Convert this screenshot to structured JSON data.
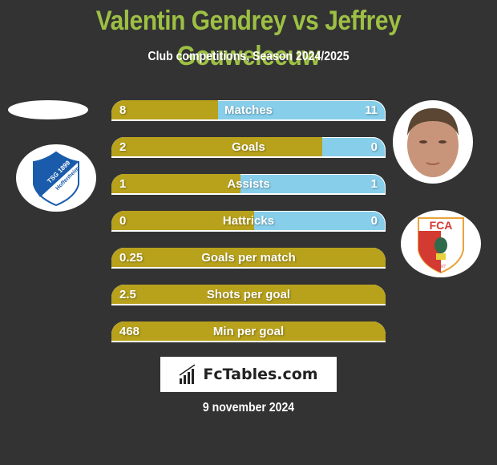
{
  "header": {
    "title": "Valentin Gendrey vs Jeffrey Gouweleeuw",
    "subtitle": "Club competitions, Season 2024/2025"
  },
  "players": {
    "left": {
      "name": "Valentin Gendrey",
      "club_logo": "tsg-1899-hoffenheim-logo",
      "club_text": "TSG 1899 Hoffenheim"
    },
    "right": {
      "name": "Jeffrey Gouweleeuw",
      "club_logo": "fc-augsburg-logo",
      "club_text": "FCA 1907"
    }
  },
  "colors": {
    "title": "#9dc044",
    "left_bar": "#b8a21c",
    "right_bar": "#87ceeb",
    "background": "#333333"
  },
  "chart_data": {
    "type": "bar",
    "title": "Valentin Gendrey vs Jeffrey Gouweleeuw",
    "subtitle": "Club competitions, Season 2024/2025",
    "categories": [
      "Matches",
      "Goals",
      "Assists",
      "Hattricks",
      "Goals per match",
      "Shots per goal",
      "Min per goal"
    ],
    "series": [
      {
        "name": "Valentin Gendrey",
        "values": [
          "8",
          "2",
          "1",
          "0",
          "0.25",
          "2.5",
          "468"
        ]
      },
      {
        "name": "Jeffrey Gouweleeuw",
        "values": [
          "11",
          "0",
          "1",
          "0",
          "",
          "",
          ""
        ]
      }
    ],
    "left_share": [
      0.39,
      0.77,
      0.5,
      0.52,
      1,
      1,
      1
    ]
  },
  "footer": {
    "brand": "FcTables.com",
    "date": "9 november 2024"
  }
}
